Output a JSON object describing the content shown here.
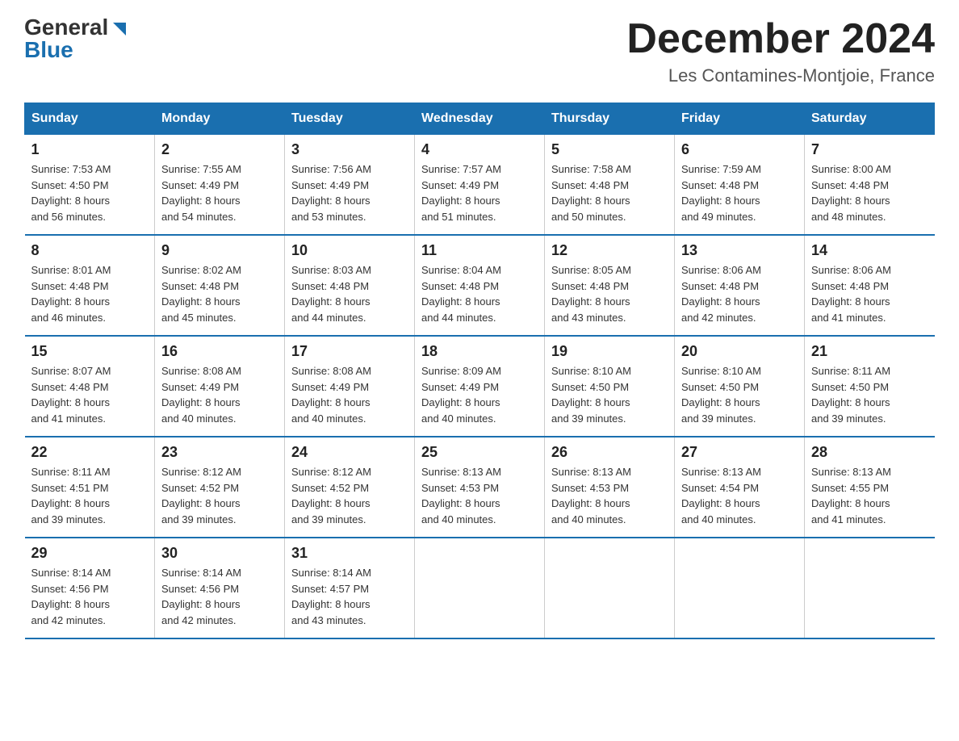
{
  "header": {
    "logo_general": "General",
    "logo_blue": "Blue",
    "month_title": "December 2024",
    "location": "Les Contamines-Montjoie, France"
  },
  "days_of_week": [
    "Sunday",
    "Monday",
    "Tuesday",
    "Wednesday",
    "Thursday",
    "Friday",
    "Saturday"
  ],
  "weeks": [
    [
      {
        "day": "1",
        "info": "Sunrise: 7:53 AM\nSunset: 4:50 PM\nDaylight: 8 hours\nand 56 minutes."
      },
      {
        "day": "2",
        "info": "Sunrise: 7:55 AM\nSunset: 4:49 PM\nDaylight: 8 hours\nand 54 minutes."
      },
      {
        "day": "3",
        "info": "Sunrise: 7:56 AM\nSunset: 4:49 PM\nDaylight: 8 hours\nand 53 minutes."
      },
      {
        "day": "4",
        "info": "Sunrise: 7:57 AM\nSunset: 4:49 PM\nDaylight: 8 hours\nand 51 minutes."
      },
      {
        "day": "5",
        "info": "Sunrise: 7:58 AM\nSunset: 4:48 PM\nDaylight: 8 hours\nand 50 minutes."
      },
      {
        "day": "6",
        "info": "Sunrise: 7:59 AM\nSunset: 4:48 PM\nDaylight: 8 hours\nand 49 minutes."
      },
      {
        "day": "7",
        "info": "Sunrise: 8:00 AM\nSunset: 4:48 PM\nDaylight: 8 hours\nand 48 minutes."
      }
    ],
    [
      {
        "day": "8",
        "info": "Sunrise: 8:01 AM\nSunset: 4:48 PM\nDaylight: 8 hours\nand 46 minutes."
      },
      {
        "day": "9",
        "info": "Sunrise: 8:02 AM\nSunset: 4:48 PM\nDaylight: 8 hours\nand 45 minutes."
      },
      {
        "day": "10",
        "info": "Sunrise: 8:03 AM\nSunset: 4:48 PM\nDaylight: 8 hours\nand 44 minutes."
      },
      {
        "day": "11",
        "info": "Sunrise: 8:04 AM\nSunset: 4:48 PM\nDaylight: 8 hours\nand 44 minutes."
      },
      {
        "day": "12",
        "info": "Sunrise: 8:05 AM\nSunset: 4:48 PM\nDaylight: 8 hours\nand 43 minutes."
      },
      {
        "day": "13",
        "info": "Sunrise: 8:06 AM\nSunset: 4:48 PM\nDaylight: 8 hours\nand 42 minutes."
      },
      {
        "day": "14",
        "info": "Sunrise: 8:06 AM\nSunset: 4:48 PM\nDaylight: 8 hours\nand 41 minutes."
      }
    ],
    [
      {
        "day": "15",
        "info": "Sunrise: 8:07 AM\nSunset: 4:48 PM\nDaylight: 8 hours\nand 41 minutes."
      },
      {
        "day": "16",
        "info": "Sunrise: 8:08 AM\nSunset: 4:49 PM\nDaylight: 8 hours\nand 40 minutes."
      },
      {
        "day": "17",
        "info": "Sunrise: 8:08 AM\nSunset: 4:49 PM\nDaylight: 8 hours\nand 40 minutes."
      },
      {
        "day": "18",
        "info": "Sunrise: 8:09 AM\nSunset: 4:49 PM\nDaylight: 8 hours\nand 40 minutes."
      },
      {
        "day": "19",
        "info": "Sunrise: 8:10 AM\nSunset: 4:50 PM\nDaylight: 8 hours\nand 39 minutes."
      },
      {
        "day": "20",
        "info": "Sunrise: 8:10 AM\nSunset: 4:50 PM\nDaylight: 8 hours\nand 39 minutes."
      },
      {
        "day": "21",
        "info": "Sunrise: 8:11 AM\nSunset: 4:50 PM\nDaylight: 8 hours\nand 39 minutes."
      }
    ],
    [
      {
        "day": "22",
        "info": "Sunrise: 8:11 AM\nSunset: 4:51 PM\nDaylight: 8 hours\nand 39 minutes."
      },
      {
        "day": "23",
        "info": "Sunrise: 8:12 AM\nSunset: 4:52 PM\nDaylight: 8 hours\nand 39 minutes."
      },
      {
        "day": "24",
        "info": "Sunrise: 8:12 AM\nSunset: 4:52 PM\nDaylight: 8 hours\nand 39 minutes."
      },
      {
        "day": "25",
        "info": "Sunrise: 8:13 AM\nSunset: 4:53 PM\nDaylight: 8 hours\nand 40 minutes."
      },
      {
        "day": "26",
        "info": "Sunrise: 8:13 AM\nSunset: 4:53 PM\nDaylight: 8 hours\nand 40 minutes."
      },
      {
        "day": "27",
        "info": "Sunrise: 8:13 AM\nSunset: 4:54 PM\nDaylight: 8 hours\nand 40 minutes."
      },
      {
        "day": "28",
        "info": "Sunrise: 8:13 AM\nSunset: 4:55 PM\nDaylight: 8 hours\nand 41 minutes."
      }
    ],
    [
      {
        "day": "29",
        "info": "Sunrise: 8:14 AM\nSunset: 4:56 PM\nDaylight: 8 hours\nand 42 minutes."
      },
      {
        "day": "30",
        "info": "Sunrise: 8:14 AM\nSunset: 4:56 PM\nDaylight: 8 hours\nand 42 minutes."
      },
      {
        "day": "31",
        "info": "Sunrise: 8:14 AM\nSunset: 4:57 PM\nDaylight: 8 hours\nand 43 minutes."
      },
      null,
      null,
      null,
      null
    ]
  ]
}
